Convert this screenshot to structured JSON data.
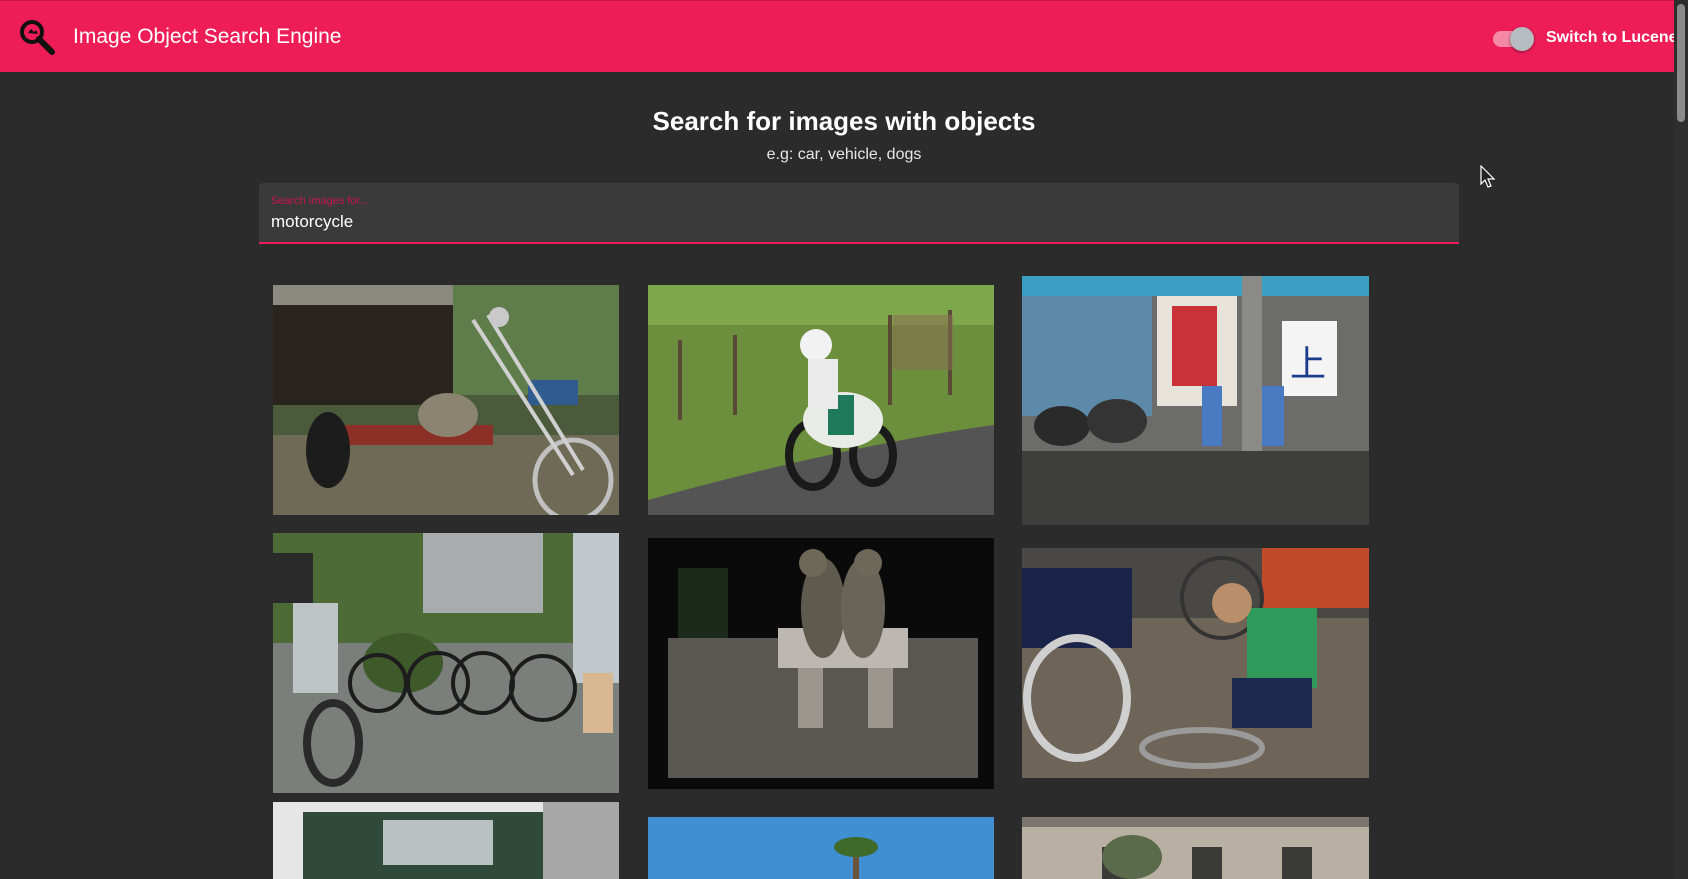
{
  "app": {
    "title": "Image Object Search Engine",
    "toggle_label": "Switch to Lucene",
    "toggle_on": true
  },
  "page": {
    "heading": "Search for images with objects",
    "example": "e.g: car, vehicle, dogs"
  },
  "search": {
    "label": "Search images for...",
    "value": "motorcycle"
  },
  "colors": {
    "accent": "#ee1d58",
    "background": "#2b2b2b",
    "field": "#3a3a3a"
  },
  "results": [
    {
      "subject": "chopper motorcycle in front of a garage"
    },
    {
      "subject": "motorcycle racer on a country road"
    },
    {
      "subject": "scooters parked on a street corner with two workers"
    },
    {
      "subject": "motorcycle and bicycles beside a fence"
    },
    {
      "subject": "bronze statues of two women on a bench"
    },
    {
      "subject": "man repairing a motorcycle wheel"
    },
    {
      "subject": "vehicle partially visible"
    },
    {
      "subject": "palm tree under a blue sky"
    },
    {
      "subject": "stone building facade"
    }
  ]
}
